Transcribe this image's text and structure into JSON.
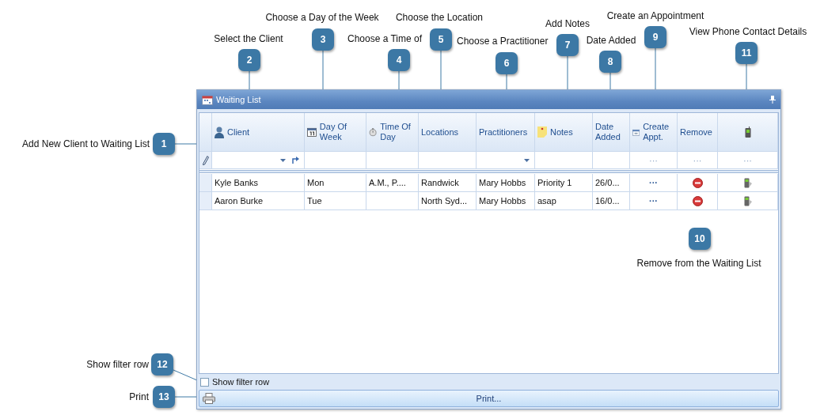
{
  "callouts": [
    {
      "number": "1",
      "label": "Add New Client to Waiting List"
    },
    {
      "number": "2",
      "label": "Select the Client"
    },
    {
      "number": "3",
      "label": "Choose a Day of the Week"
    },
    {
      "number": "4",
      "label": "Choose a Time of"
    },
    {
      "number": "5",
      "label": "Choose the Location"
    },
    {
      "number": "6",
      "label": "Choose a Practitioner"
    },
    {
      "number": "7",
      "label": "Add Notes"
    },
    {
      "number": "8",
      "label": "Date Added"
    },
    {
      "number": "9",
      "label": "Create an Appointment"
    },
    {
      "number": "10",
      "label": "Remove from the Waiting List"
    },
    {
      "number": "11",
      "label": "View Phone Contact Details"
    },
    {
      "number": "12",
      "label": "Show filter row"
    },
    {
      "number": "13",
      "label": "Print"
    }
  ],
  "window": {
    "title": "Waiting List"
  },
  "table": {
    "columns": [
      "Client",
      "Day Of Week",
      "Time Of Day",
      "Locations",
      "Practitioners",
      "Notes",
      "Date Added",
      "Create Appt.",
      "Remove"
    ],
    "filter_row": {
      "create": "···",
      "remove": "···",
      "phone": "···"
    },
    "rows": [
      {
        "cells": [
          "Kyle Banks",
          "Mon",
          "A.M., P....",
          "Randwick",
          "Mary Hobbs",
          "Priority 1",
          "26/0..."
        ],
        "create": "···"
      },
      {
        "cells": [
          "Aaron Burke",
          "Tue",
          "",
          "North Syd...",
          "Mary Hobbs",
          "asap",
          "16/0..."
        ],
        "create": "···"
      }
    ]
  },
  "show_filter_row": {
    "label": "Show filter row",
    "checked": false
  },
  "print_button": {
    "label": "Print..."
  }
}
